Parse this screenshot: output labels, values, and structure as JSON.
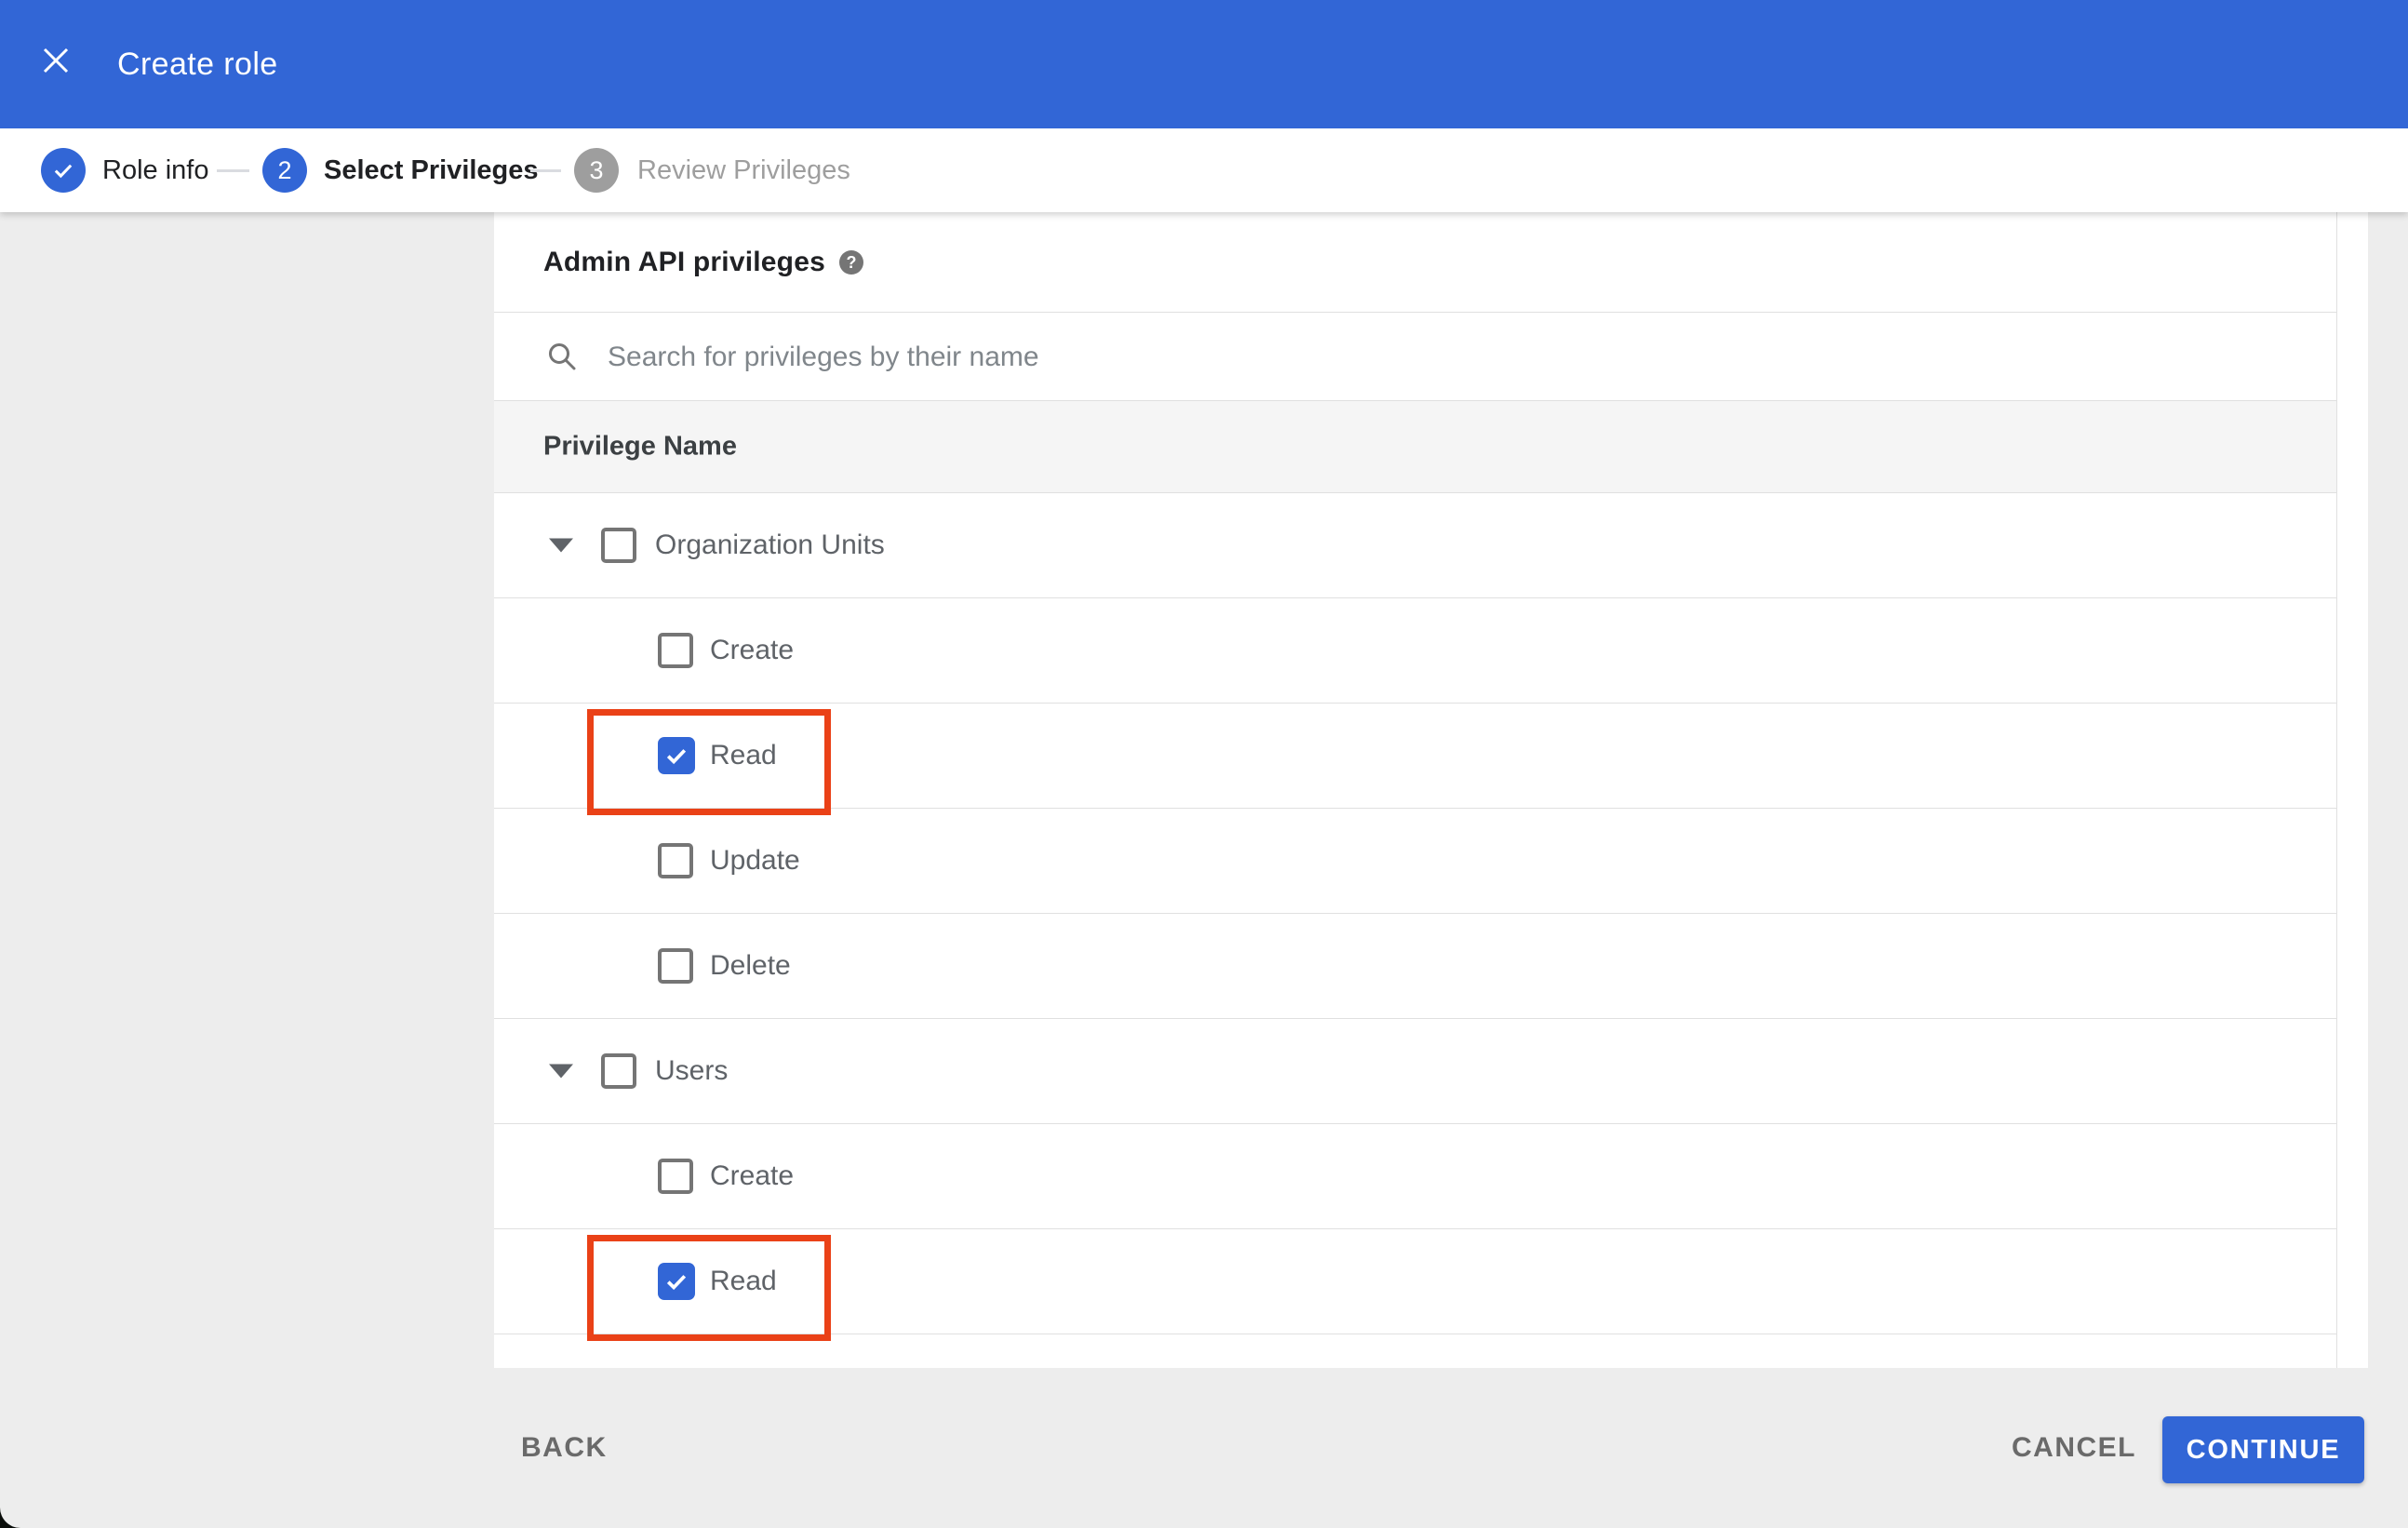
{
  "app": {
    "title": "Create role",
    "colors": {
      "accent_blue": "#3266d6",
      "highlight_red": "#ea4117",
      "page_background": "#ededed",
      "table_header_background": "#f5f5f5",
      "divider": "#e0e0e0"
    }
  },
  "stepper": {
    "steps": [
      {
        "number": "1",
        "label": "Role info",
        "state": "completed"
      },
      {
        "number": "2",
        "label": "Select Privileges",
        "state": "active"
      },
      {
        "number": "3",
        "label": "Review Privileges",
        "state": "upcoming"
      }
    ]
  },
  "content": {
    "section_title": "Admin API privileges",
    "help_icon_glyph": "?",
    "search": {
      "placeholder": "Search for privileges by their name"
    },
    "table": {
      "header": "Privilege Name",
      "groups": [
        {
          "label": "Organization Units",
          "checked": false,
          "expanded": true,
          "children": [
            {
              "label": "Create",
              "checked": false,
              "highlighted": false
            },
            {
              "label": "Read",
              "checked": true,
              "highlighted": true
            },
            {
              "label": "Update",
              "checked": false,
              "highlighted": false
            },
            {
              "label": "Delete",
              "checked": false,
              "highlighted": false
            }
          ]
        },
        {
          "label": "Users",
          "checked": false,
          "expanded": true,
          "children": [
            {
              "label": "Create",
              "checked": false,
              "highlighted": false
            },
            {
              "label": "Read",
              "checked": true,
              "highlighted": true
            }
          ]
        }
      ]
    }
  },
  "footer": {
    "back_label": "BACK",
    "cancel_label": "CANCEL",
    "continue_label": "CONTINUE"
  }
}
